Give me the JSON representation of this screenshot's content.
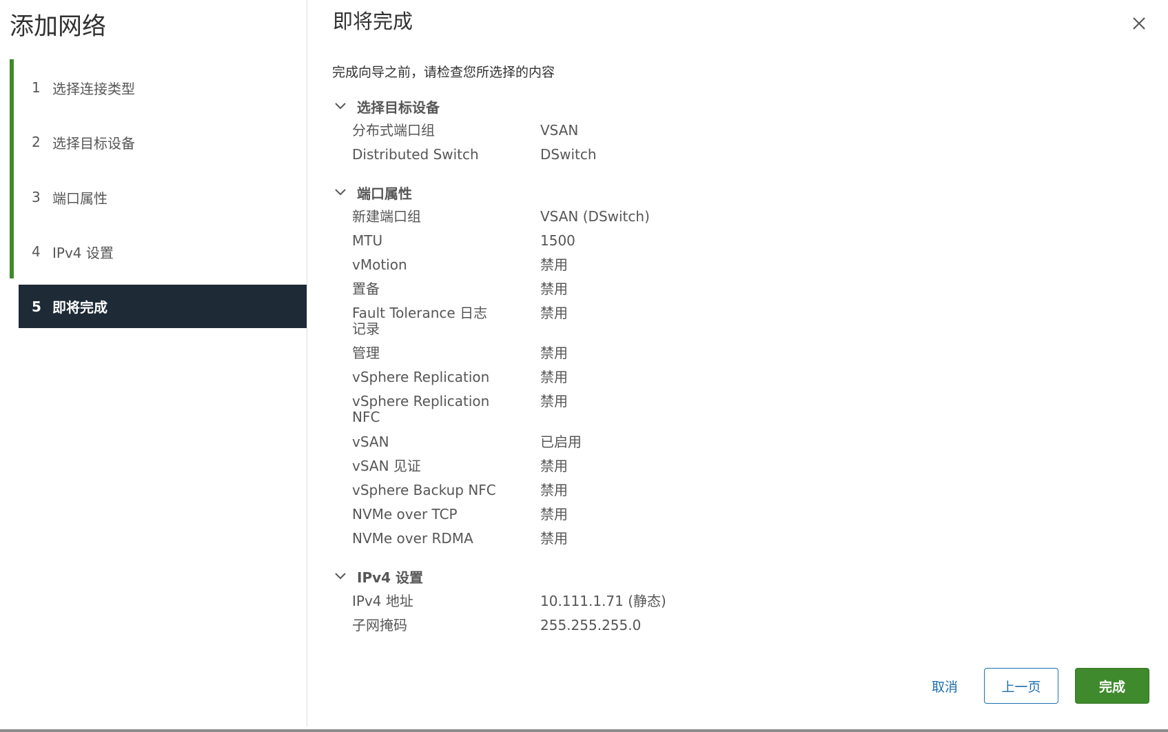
{
  "wizard": {
    "title": "添加网络",
    "steps": [
      {
        "num": "1",
        "label": "选择连接类型"
      },
      {
        "num": "2",
        "label": "选择目标设备"
      },
      {
        "num": "3",
        "label": "端口属性"
      },
      {
        "num": "4",
        "label": "IPv4 设置"
      },
      {
        "num": "5",
        "label": "即将完成"
      }
    ],
    "active_step": 5
  },
  "page": {
    "title": "即将完成",
    "intro": "完成向导之前，请检查您所选择的内容"
  },
  "sections": {
    "target_device": {
      "title": "选择目标设备",
      "rows": [
        {
          "label": "分布式端口组",
          "value": "VSAN"
        },
        {
          "label": "Distributed Switch",
          "value": "DSwitch"
        }
      ]
    },
    "port_properties": {
      "title": "端口属性",
      "rows": [
        {
          "label": "新建端口组",
          "value": "VSAN (DSwitch)"
        },
        {
          "label": "MTU",
          "value": "1500"
        },
        {
          "label": "vMotion",
          "value": "禁用"
        },
        {
          "label": "置备",
          "value": "禁用"
        },
        {
          "label": "Fault Tolerance 日志记录",
          "value": "禁用"
        },
        {
          "label": "管理",
          "value": "禁用"
        },
        {
          "label": "vSphere Replication",
          "value": "禁用"
        },
        {
          "label": "vSphere Replication NFC",
          "value": "禁用"
        },
        {
          "label": "vSAN",
          "value": "已启用"
        },
        {
          "label": "vSAN 见证",
          "value": "禁用"
        },
        {
          "label": "vSphere Backup NFC",
          "value": "禁用"
        },
        {
          "label": "NVMe over TCP",
          "value": "禁用"
        },
        {
          "label": "NVMe over RDMA",
          "value": "禁用"
        }
      ]
    },
    "ipv4": {
      "title": "IPv4 设置",
      "rows": [
        {
          "label": "IPv4 地址",
          "value": "10.111.1.71 (静态)"
        },
        {
          "label": "子网掩码",
          "value": "255.255.255.0"
        }
      ]
    }
  },
  "footer": {
    "cancel_label": "取消",
    "back_label": "上一页",
    "finish_label": "完成"
  },
  "colors": {
    "accent_green": "#3f8a2c",
    "active_step_bg": "#1e2a35",
    "link_blue": "#1b6fb0"
  },
  "icons": {
    "close": "close-icon",
    "section_toggle": "chevron-down-icon"
  }
}
